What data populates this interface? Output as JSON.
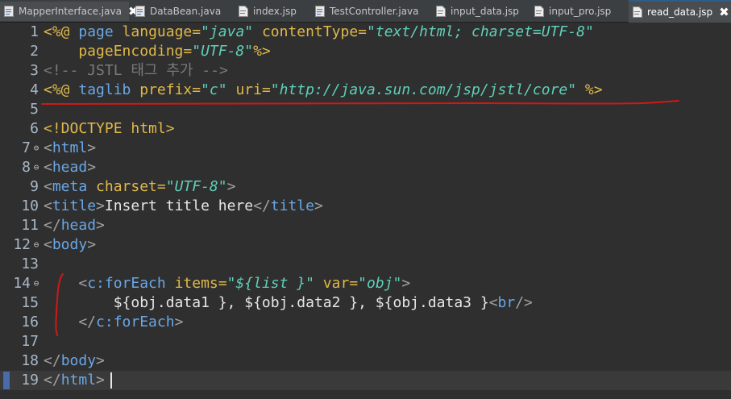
{
  "tabs": [
    {
      "label": "MapperInterface.java",
      "icon": "java-file-icon",
      "active": false,
      "closable": true
    },
    {
      "label": "DataBean.java",
      "icon": "java-file-icon",
      "active": false
    },
    {
      "label": "index.jsp",
      "icon": "jsp-file-icon",
      "active": false
    },
    {
      "label": "TestController.java",
      "icon": "java-file-icon",
      "active": false
    },
    {
      "label": "input_data.jsp",
      "icon": "jsp-file-icon",
      "active": false
    },
    {
      "label": "input_pro.jsp",
      "icon": "jsp-file-icon",
      "active": false
    },
    {
      "label": "read_data.jsp",
      "icon": "jsp-file-icon",
      "active": true,
      "closable": true
    }
  ],
  "close_glyph": "✖",
  "fold_glyph": "⊖",
  "editor": {
    "line_numbers": [
      "1",
      "2",
      "3",
      "4",
      "5",
      "6",
      "7",
      "8",
      "9",
      "10",
      "11",
      "12",
      "13",
      "14",
      "15",
      "16",
      "17",
      "18",
      "19"
    ],
    "folded_lines": [
      "7",
      "8",
      "12",
      "14"
    ],
    "lines": {
      "l1": {
        "a": "<%@ ",
        "b": "page",
        "c": " language=",
        "d": "\"java\"",
        "e": " contentType=",
        "f": "\"text/html; charset=UTF-8\""
      },
      "l2": {
        "a": "    pageEncoding=",
        "b": "\"UTF-8\"",
        "c": "%>"
      },
      "l3": {
        "a": "<!-- JSTL 태그 추가 -->"
      },
      "l4": {
        "a": "<%@ ",
        "b": "taglib",
        "c": " prefix=",
        "d": "\"c\"",
        "e": " uri=",
        "f": "\"http://java.sun.com/jsp/jstl/core\"",
        "g": " %>"
      },
      "l6": {
        "a": "<!DOCTYPE ",
        "b": "html",
        "c": ">"
      },
      "l7": {
        "a": "<",
        "b": "html",
        "c": ">"
      },
      "l8": {
        "a": "<",
        "b": "head",
        "c": ">"
      },
      "l9": {
        "a": "<",
        "b": "meta",
        "c": " charset=",
        "d": "\"UTF-8\"",
        "e": ">"
      },
      "l10": {
        "a": "<",
        "b": "title",
        "c": ">",
        "d": "Insert title here",
        "e": "</",
        "f": "title",
        "g": ">"
      },
      "l11": {
        "a": "</",
        "b": "head",
        "c": ">"
      },
      "l12": {
        "a": "<",
        "b": "body",
        "c": ">"
      },
      "l14": {
        "a": "    <",
        "b": "c:forEach",
        "c": " items=",
        "d": "\"${list }\"",
        "e": " var=",
        "f": "\"obj\"",
        "g": ">"
      },
      "l15": {
        "a": "        ${obj.data1 }, ${obj.data2 }, ${obj.data3 }",
        "b": "<",
        "c": "br",
        "d": "/>"
      },
      "l16": {
        "a": "    </",
        "b": "c:forEach",
        "c": ">"
      },
      "l18": {
        "a": "</",
        "b": "body",
        "c": ">"
      },
      "l19": {
        "a": "</",
        "b": "html",
        "c": ">"
      }
    }
  },
  "colors": {
    "background": "#2f2f2f",
    "directive": "#e0b84a",
    "keyword": "#6aa7e6",
    "string": "#5fd0b8",
    "comment": "#7a7a7a",
    "annotation_red": "#d01818"
  }
}
